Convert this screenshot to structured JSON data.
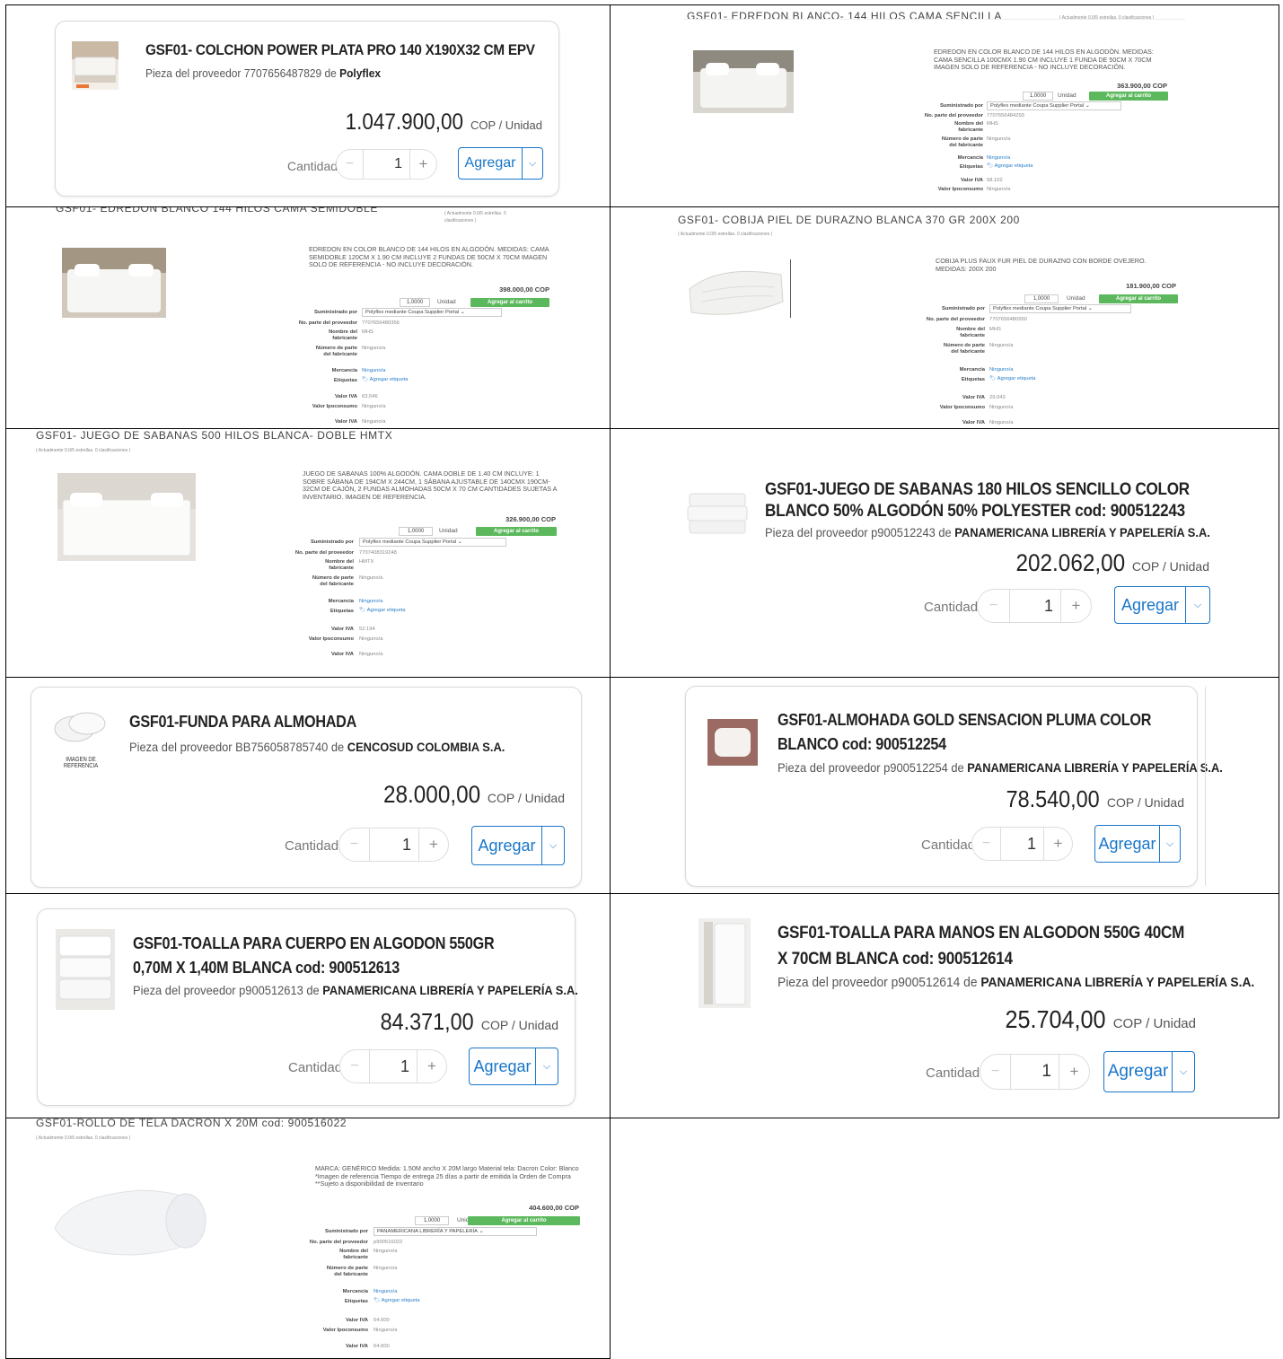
{
  "labels": {
    "qty": "Cantidad",
    "add": "Agregar",
    "unit": "COP / Unidad",
    "add_cart": "Agregar al carrito",
    "unidad": "Unidad",
    "qty_old": "1,0000",
    "qty_new": "1",
    "supplied_by": "Suministrado por",
    "part_no": "No. parte del proveedor",
    "maker_name": "Nombre del fabricante",
    "maker_part": "Número de parte del fabricante",
    "merchandise": "Mercancía",
    "tags": "Etiquetas",
    "iva": "Valor IVA",
    "ipoconsumo": "Valor Ipoconsumo",
    "none": "Ninguno/a",
    "add_tag": "Agregar etiqueta",
    "rating": "( Actualmente 0.0/5 estrellas. 0 clasificaciones )"
  },
  "p1": {
    "title": "GSF01- COLCHON POWER PLATA PRO 140 X190X32 CM EPV",
    "supplier_text": "Pieza del proveedor 7707656487829 de",
    "supplier": "Polyflex",
    "price": "1.047.900,00"
  },
  "p2": {
    "title": "GSF01- EDREDON BLANCO- 144 HILOS CAMA SENCILLA",
    "desc": "EDREDON EN COLOR BLANCO DE 144 HILOS EN ALGODÓN. MEDIDAS: CAMA SENCILLA 100CMX 1.90 CM INCLUYE 1 FUNDA DE 50CM X 70CM IMAGEN SOLO DE REFERENCIA - NO INCLUYE DECORACIÓN.",
    "price": "363.900,00 COP",
    "supplier": "Polyflex mediante Coupa Supplier Portal",
    "part_no": "7707656484293",
    "maker": "MHS",
    "iva": "58.102"
  },
  "p3": {
    "title": "GSF01- EDREDON BLANCO 144 HILOS CAMA SEMIDOBLE",
    "desc": "EDREDON EN COLOR BLANCO DE 144 HILOS EN ALGODÓN. MEDIDAS: CAMA SEMIDOBLE 120CM X 1.90 CM INCLUYE 2 FUNDAS DE 50CM X 70CM IMAGEN SOLO DE REFERENCIA - NO INCLUYE DECORACIÓN.",
    "price": "398.000,00 COP",
    "supplier": "Polyflex mediante Coupa Supplier Portal",
    "part_no": "7707656480356",
    "maker": "MHS",
    "iva": "63.546"
  },
  "p4": {
    "title": "GSF01- COBIJA PIEL DE DURAZNO BLANCA 370 GR 200X 200",
    "desc": "COBIJA PLUS FAUX FUR PIEL DE DURAZNO CON BORDE OVEJERO. MEDIDAS: 200X 200",
    "price": "181.900,00 COP",
    "supplier": "Polyflex mediante Coupa Supplier Portal",
    "part_no": "7707656480950",
    "maker": "MHS",
    "iva": "29.043"
  },
  "p5": {
    "title": "GSF01- JUEGO DE SABANAS 500 HILOS BLANCA- DOBLE HMTX",
    "desc": "JUEGO DE SABANAS 100% ALGODÓN. CAMA DOBLE DE 1.40 CM INCLUYE: 1 SOBRE SÁBANA DE 194CM X 244CM, 1 SÁBANA AJUSTABLE DE 140CMX 190CM- 32CM DE CAJÓN, 2 FUNDAS ALMOHADAS 50CM X 70 CM CANTIDADES SUJETAS A INVENTARIO. IMAGEN DE REFERENCIA.",
    "price": "326.900,00 COP",
    "supplier": "Polyflex mediante Coupa Supplier Portal",
    "part_no": "7707408319248",
    "maker": "HMTX",
    "iva": "52.194"
  },
  "p6": {
    "title": "GSF01-JUEGO DE SABANAS 180 HILOS SENCILLO COLOR BLANCO 50% ALGODÓN 50% POLYESTER cod: 900512243",
    "supplier_text": "Pieza del proveedor p900512243 de",
    "supplier": "PANAMERICANA LIBRERÍA Y PAPELERÍA S.A.",
    "price": "202.062,00"
  },
  "p7": {
    "title": "GSF01-FUNDA PARA ALMOHADA",
    "supplier_text": "Pieza del proveedor BB756058785740 de",
    "supplier": "CENCOSUD COLOMBIA S.A.",
    "price": "28.000,00",
    "img_caption": "IMAGEN DE REFERENCIA"
  },
  "p8": {
    "title": "GSF01-ALMOHADA GOLD SENSACION PLUMA COLOR BLANCO cod: 900512254",
    "supplier_text": "Pieza del proveedor p900512254 de",
    "supplier": "PANAMERICANA LIBRERÍA Y PAPELERÍA S.A.",
    "price": "78.540,00"
  },
  "p9": {
    "title": "GSF01-TOALLA PARA CUERPO EN ALGODON 550GR 0,70M X 1,40M BLANCA cod: 900512613",
    "supplier_text": "Pieza del proveedor p900512613 de",
    "supplier": "PANAMERICANA LIBRERÍA Y PAPELERÍA S.A.",
    "price": "84.371,00"
  },
  "p10": {
    "title": "GSF01-TOALLA PARA MANOS EN ALGODON 550G 40CM X 70CM BLANCA cod: 900512614",
    "supplier_text": "Pieza del proveedor p900512614 de",
    "supplier": "PANAMERICANA LIBRERÍA Y PAPELERÍA S.A.",
    "price": "25.704,00"
  },
  "p11": {
    "title": "GSF01-ROLLO DE TELA DACRON X 20M cod: 900516022",
    "desc": "MARCA: GENÉRICO Medida: 1.50M ancho X 20M largo Material tela: Dacron Color: Blanco *Imagen de referencia Tiempo de entrega 25 días a partir de emitida la Orden de Compra **Sujeto a disponibilidad de inventario",
    "price": "404.600,00 COP",
    "supplier": "PANAMERICANA LIBRERÍA Y PAPELERÍA",
    "part_no": "p900516022",
    "maker": "Ninguno/a",
    "iva": "64.600",
    "iva2": "64.600"
  },
  "colors": {
    "accent": "#1976c9",
    "cart_green": "#5cb85c",
    "link": "#2a7fc9"
  }
}
